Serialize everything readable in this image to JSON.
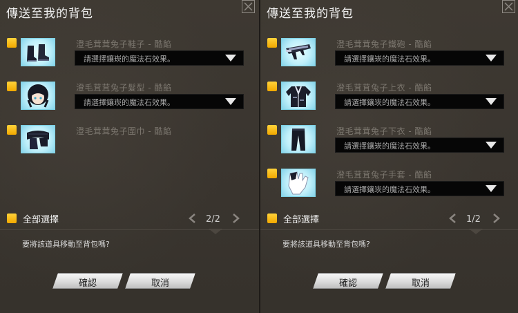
{
  "left_panel": {
    "title": "傳送至我的背包",
    "items": [
      {
        "name": "澄毛茸茸兔子鞋子 - 酷餡",
        "thumb_icon": "boots-icon",
        "select_placeholder": "請選擇鑲崁的魔法石效果。",
        "has_select": true
      },
      {
        "name": "澄毛茸茸兔子髮型 - 酷餡",
        "thumb_icon": "hair-icon",
        "select_placeholder": "請選擇鑲崁的魔法石效果。",
        "has_select": true
      },
      {
        "name": "澄毛茸茸兔子圍巾 - 酷餡",
        "thumb_icon": "scarf-icon",
        "has_select": false
      }
    ],
    "select_all_label": "全部選擇",
    "pager": "2/2",
    "question": "要將該道具移動至背包嗎?",
    "confirm_label": "確認",
    "cancel_label": "取消"
  },
  "right_panel": {
    "title": "傳送至我的背包",
    "items": [
      {
        "name": "澄毛茸茸兔子鐵砲 - 酷餡",
        "thumb_icon": "gun-icon",
        "select_placeholder": "請選擇鑲崁的魔法石效果。",
        "has_select": true
      },
      {
        "name": "澄毛茸茸兔子上衣 - 酷餡",
        "thumb_icon": "jacket-icon",
        "select_placeholder": "請選擇鑲崁的魔法石效果。",
        "has_select": true
      },
      {
        "name": "澄毛茸茸兔子下衣 - 酷餡",
        "thumb_icon": "pants-icon",
        "select_placeholder": "請選擇鑲崁的魔法石效果。",
        "has_select": true
      },
      {
        "name": "澄毛茸茸兔子手套 - 酷餡",
        "thumb_icon": "glove-icon",
        "select_placeholder": "請選擇鑲崁的魔法石效果。",
        "has_select": true
      }
    ],
    "select_all_label": "全部選擇",
    "pager": "1/2",
    "question": "要將該道具移動至背包嗎?",
    "confirm_label": "確認",
    "cancel_label": "取消"
  },
  "colors": {
    "accent_checkbox": "#f2b400",
    "thumb_bg": "#bfeffa",
    "panel_bg": "#3a352f"
  }
}
